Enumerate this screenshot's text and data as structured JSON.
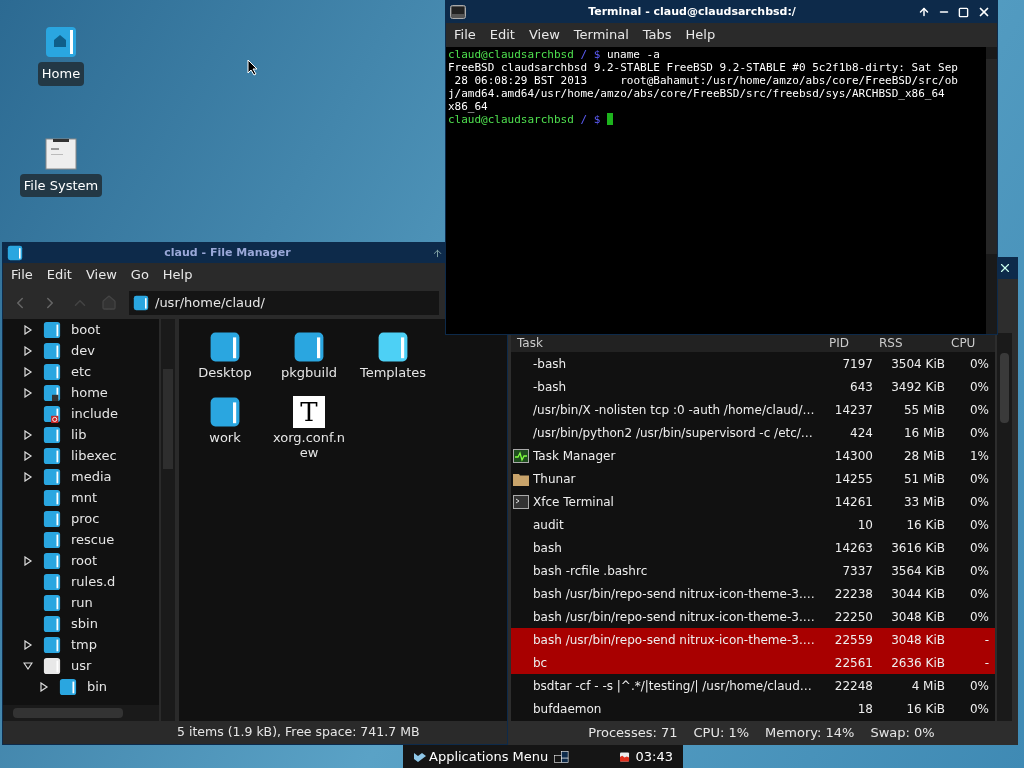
{
  "desktop": {
    "icons": [
      {
        "label": "Home",
        "kind": "home"
      },
      {
        "label": "File System",
        "kind": "drive"
      }
    ]
  },
  "file_manager": {
    "title": "claud - File Manager",
    "menu": [
      "File",
      "Edit",
      "View",
      "Go",
      "Help"
    ],
    "location": "/usr/home/claud/",
    "tree": [
      {
        "name": "boot",
        "expandable": true,
        "expanded": false,
        "kind": "folder"
      },
      {
        "name": "dev",
        "expandable": true,
        "expanded": false,
        "kind": "folder"
      },
      {
        "name": "etc",
        "expandable": true,
        "expanded": false,
        "kind": "folder"
      },
      {
        "name": "home",
        "expandable": true,
        "expanded": false,
        "kind": "link"
      },
      {
        "name": "include",
        "expandable": false,
        "kind": "restricted"
      },
      {
        "name": "lib",
        "expandable": true,
        "expanded": false,
        "kind": "folder"
      },
      {
        "name": "libexec",
        "expandable": true,
        "expanded": false,
        "kind": "folder"
      },
      {
        "name": "media",
        "expandable": true,
        "expanded": false,
        "kind": "folder"
      },
      {
        "name": "mnt",
        "expandable": false,
        "kind": "folder"
      },
      {
        "name": "proc",
        "expandable": false,
        "kind": "folder"
      },
      {
        "name": "rescue",
        "expandable": false,
        "kind": "folder"
      },
      {
        "name": "root",
        "expandable": true,
        "expanded": false,
        "kind": "folder"
      },
      {
        "name": "rules.d",
        "expandable": false,
        "kind": "folder"
      },
      {
        "name": "run",
        "expandable": false,
        "kind": "folder"
      },
      {
        "name": "sbin",
        "expandable": false,
        "kind": "folder"
      },
      {
        "name": "tmp",
        "expandable": true,
        "expanded": false,
        "kind": "folder"
      },
      {
        "name": "usr",
        "expandable": true,
        "expanded": true,
        "kind": "system",
        "children": [
          {
            "name": "bin",
            "expandable": true,
            "expanded": false,
            "kind": "folder"
          }
        ]
      }
    ],
    "items": [
      {
        "name": "Desktop",
        "kind": "folder"
      },
      {
        "name": "pkgbuild",
        "kind": "folder"
      },
      {
        "name": "Templates",
        "kind": "templates"
      },
      {
        "name": "work",
        "kind": "folder"
      },
      {
        "name": "xorg.conf.new",
        "kind": "text",
        "glyph": "T"
      }
    ],
    "status": "5 items (1.9 kB), Free space: 741.7 MB"
  },
  "terminal": {
    "title": "Terminal - claud@claudsarchbsd:/",
    "menu": [
      "File",
      "Edit",
      "View",
      "Terminal",
      "Tabs",
      "Help"
    ],
    "lines": [
      {
        "kind": "prompt",
        "user": "claud@claudsarchbsd",
        "path": "/",
        "symbol": "$",
        "command": "uname -a",
        "cursor": false
      },
      {
        "kind": "output",
        "text": "FreeBSD claudsarchbsd 9.2-STABLE FreeBSD 9.2-STABLE #0 5c2f1b8-dirty: Sat Sep"
      },
      {
        "kind": "output",
        "text": " 28 06:08:29 BST 2013     root@Bahamut:/usr/home/amzo/abs/core/FreeBSD/src/ob"
      },
      {
        "kind": "output",
        "text": "j/amd64.amd64/usr/home/amzo/abs/core/FreeBSD/src/freebsd/sys/ARCHBSD_x86_64"
      },
      {
        "kind": "output",
        "text": "x86_64"
      },
      {
        "kind": "prompt",
        "user": "claud@claudsarchbsd",
        "path": "/",
        "symbol": "$",
        "cursor": true
      }
    ]
  },
  "task_manager": {
    "columns": [
      "Task",
      "PID",
      "RSS",
      "CPU"
    ],
    "rows": [
      {
        "task": "-bash",
        "pid": "7197",
        "rss": "3504 KiB",
        "cpu": "0%",
        "kind": "process",
        "highlighted": false
      },
      {
        "task": "-bash",
        "pid": "643",
        "rss": "3492 KiB",
        "cpu": "0%",
        "kind": "process",
        "highlighted": false
      },
      {
        "task": "/usr/bin/X -nolisten tcp :0 -auth /home/claud/…",
        "pid": "14237",
        "rss": "55 MiB",
        "cpu": "0%",
        "kind": "process",
        "highlighted": false
      },
      {
        "task": "/usr/bin/python2 /usr/bin/supervisord -c /etc/…",
        "pid": "424",
        "rss": "16 MiB",
        "cpu": "0%",
        "kind": "process",
        "highlighted": false
      },
      {
        "task": "Task Manager",
        "pid": "14300",
        "rss": "28 MiB",
        "cpu": "1%",
        "kind": "monitor",
        "highlighted": false
      },
      {
        "task": "Thunar",
        "pid": "14255",
        "rss": "51 MiB",
        "cpu": "0%",
        "kind": "folder",
        "highlighted": false
      },
      {
        "task": "Xfce Terminal",
        "pid": "14261",
        "rss": "33 MiB",
        "cpu": "0%",
        "kind": "terminal",
        "highlighted": false
      },
      {
        "task": "audit",
        "pid": "10",
        "rss": "16 KiB",
        "cpu": "0%",
        "kind": "process",
        "highlighted": false
      },
      {
        "task": "bash",
        "pid": "14263",
        "rss": "3616 KiB",
        "cpu": "0%",
        "kind": "process",
        "highlighted": false
      },
      {
        "task": "bash -rcfile .bashrc",
        "pid": "7337",
        "rss": "3564 KiB",
        "cpu": "0%",
        "kind": "process",
        "highlighted": false
      },
      {
        "task": "bash /usr/bin/repo-send nitrux-icon-theme-3.…",
        "pid": "22238",
        "rss": "3044 KiB",
        "cpu": "0%",
        "kind": "process",
        "highlighted": false
      },
      {
        "task": "bash /usr/bin/repo-send nitrux-icon-theme-3.…",
        "pid": "22250",
        "rss": "3048 KiB",
        "cpu": "0%",
        "kind": "process",
        "highlighted": false
      },
      {
        "task": "bash /usr/bin/repo-send nitrux-icon-theme-3.…",
        "pid": "22559",
        "rss": "3048 KiB",
        "cpu": "-",
        "kind": "process",
        "highlighted": true
      },
      {
        "task": "bc",
        "pid": "22561",
        "rss": "2636 KiB",
        "cpu": "-",
        "kind": "process",
        "highlighted": true
      },
      {
        "task": "bsdtar -cf - -s |^.*/|testing/| /usr/home/claud…",
        "pid": "22248",
        "rss": "4 MiB",
        "cpu": "0%",
        "kind": "process",
        "highlighted": false
      },
      {
        "task": "bufdaemon",
        "pid": "18",
        "rss": "16 KiB",
        "cpu": "0%",
        "kind": "process",
        "highlighted": false
      }
    ],
    "status": [
      "Processes: 71",
      "CPU: 1%",
      "Memory: 14%",
      "Swap: 0%"
    ]
  },
  "panel": {
    "menu_button": "Applications Menu",
    "clock": "03:43"
  }
}
